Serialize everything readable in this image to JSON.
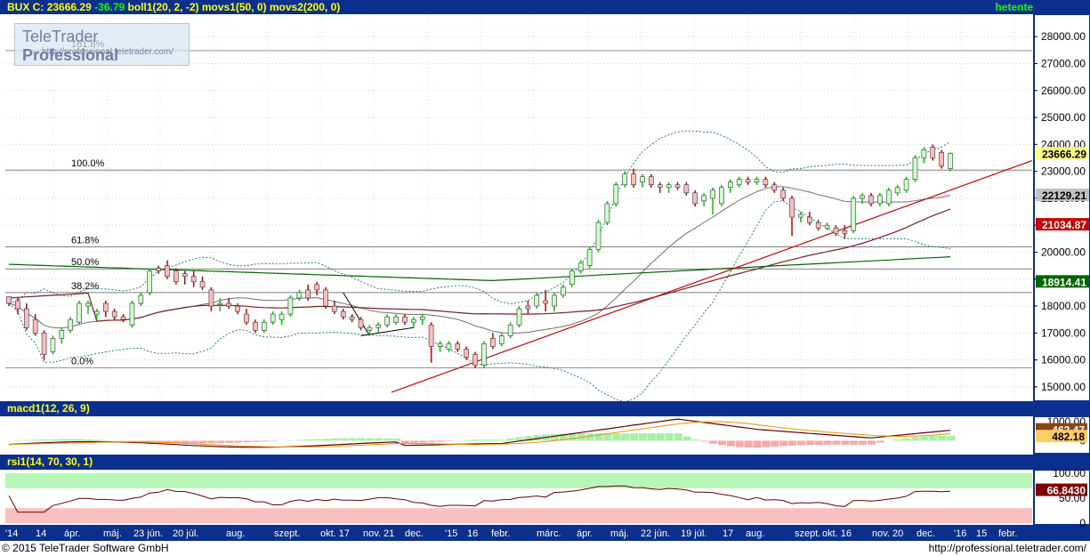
{
  "header": {
    "symbol": "BUX C:",
    "price": "23666.29",
    "change": "-36.79",
    "indicators": "boll1(20, 2, -2) movs1(50, 0) movs2(200, 0)",
    "period": "hetente"
  },
  "logo": {
    "brand": "TeleTrader",
    "product": "Professional",
    "url": "http://professional.teletrader.com/"
  },
  "macd_header": {
    "label": "macd1(12, 26, 9)"
  },
  "rsi_header": {
    "label": "rsi1(14, 70, 30, 1)"
  },
  "footer": {
    "copyright": "© 2015 TeleTrader Software GmbH",
    "url": "http://professional.teletrader.com/"
  },
  "colors": {
    "up": "#00cc00",
    "down": "#cc0000",
    "up_body": "#ccffcc",
    "down_body": "#ffbbbb",
    "bollinger": "#208080",
    "movs1": "#707070",
    "movs2": "#006600",
    "trendline": "#cc0000",
    "axis_bg": "#0a2f8c"
  },
  "chart_data": [
    {
      "type": "candlestick",
      "title": "BUX",
      "ylim": [
        14600,
        28700
      ],
      "y_ticks": [
        "15000.00",
        "16000.00",
        "17000.00",
        "18000.00",
        "19000.00",
        "20000.00",
        "21000.00",
        "22000.00",
        "23000.00",
        "24000.00",
        "25000.00",
        "26000.00",
        "27000.00",
        "28000.00"
      ],
      "price_labels": [
        {
          "value": "23666.29",
          "y": 23666.29,
          "bg": "#ffff80",
          "fg": "#000000"
        },
        {
          "value": "22129.21",
          "y": 22129.21,
          "bg": "#c0c0c0",
          "fg": "#000000"
        },
        {
          "value": "21034.87",
          "y": 21034.87,
          "bg": "#cc0000",
          "fg": "#ffffff"
        },
        {
          "value": "18914.41",
          "y": 18914.41,
          "bg": "#006600",
          "fg": "#ffffff"
        }
      ],
      "fibonacci": [
        {
          "label": "161.8%",
          "y": 27480
        },
        {
          "label": "100.0%",
          "y": 23050
        },
        {
          "label": "61.8%",
          "y": 20200
        },
        {
          "label": "50.0%",
          "y": 19380
        },
        {
          "label": "38.2%",
          "y": 18500
        },
        {
          "label": "0.0%",
          "y": 15700
        }
      ],
      "candles": [
        [
          18350,
          18350,
          18000,
          18100
        ],
        [
          18200,
          18300,
          17700,
          17900
        ],
        [
          17900,
          18100,
          17100,
          17200
        ],
        [
          17500,
          17700,
          16900,
          17000
        ],
        [
          17000,
          17100,
          16000,
          16200
        ],
        [
          16300,
          16900,
          16200,
          16800
        ],
        [
          16800,
          17200,
          16600,
          17100
        ],
        [
          17100,
          17600,
          17000,
          17500
        ],
        [
          17400,
          18200,
          17300,
          18100
        ],
        [
          18000,
          18200,
          17700,
          18100
        ],
        [
          17700,
          17900,
          17500,
          17800
        ],
        [
          18100,
          18200,
          17600,
          17800
        ],
        [
          17800,
          17900,
          17500,
          17600
        ],
        [
          17600,
          17700,
          17400,
          17500
        ],
        [
          17300,
          18200,
          17200,
          18100
        ],
        [
          18100,
          18500,
          18000,
          18400
        ],
        [
          18500,
          19400,
          18400,
          19300
        ],
        [
          19400,
          19500,
          19200,
          19300
        ],
        [
          19500,
          19700,
          19000,
          19100
        ],
        [
          19300,
          19400,
          18800,
          18900
        ],
        [
          19200,
          19300,
          18800,
          19100
        ],
        [
          19100,
          19300,
          18700,
          18900
        ],
        [
          18900,
          19100,
          18600,
          18700
        ],
        [
          18600,
          18700,
          17800,
          18000
        ],
        [
          18100,
          18300,
          17800,
          18100
        ],
        [
          18100,
          18300,
          17900,
          18000
        ],
        [
          18000,
          18100,
          17700,
          17800
        ],
        [
          17700,
          17900,
          17300,
          17400
        ],
        [
          17400,
          17500,
          17000,
          17100
        ],
        [
          17100,
          17500,
          17000,
          17400
        ],
        [
          17400,
          17800,
          17300,
          17700
        ],
        [
          17500,
          17800,
          17300,
          17700
        ],
        [
          17700,
          18400,
          17600,
          18300
        ],
        [
          18300,
          18600,
          18200,
          18500
        ],
        [
          18600,
          18800,
          18200,
          18300
        ],
        [
          18800,
          18900,
          18400,
          18600
        ],
        [
          18600,
          18700,
          17900,
          18000
        ],
        [
          18000,
          18200,
          17700,
          17800
        ],
        [
          17800,
          17900,
          17500,
          17600
        ],
        [
          17600,
          17700,
          17400,
          17500
        ],
        [
          17500,
          17600,
          17100,
          17200
        ],
        [
          17100,
          17300,
          16900,
          17200
        ],
        [
          17200,
          17400,
          17000,
          17300
        ],
        [
          17300,
          17700,
          17200,
          17600
        ],
        [
          17400,
          17700,
          17300,
          17600
        ],
        [
          17600,
          17700,
          17300,
          17400
        ],
        [
          17400,
          17600,
          17200,
          17500
        ],
        [
          17500,
          17700,
          17300,
          17600
        ],
        [
          17300,
          17400,
          15900,
          16500
        ],
        [
          16500,
          16700,
          16300,
          16600
        ],
        [
          16400,
          16700,
          16300,
          16600
        ],
        [
          16600,
          16700,
          16300,
          16400
        ],
        [
          16400,
          16500,
          16000,
          16100
        ],
        [
          16200,
          16300,
          15700,
          15800
        ],
        [
          15800,
          16700,
          15700,
          16600
        ],
        [
          16800,
          17000,
          16400,
          16500
        ],
        [
          16600,
          17000,
          16500,
          16900
        ],
        [
          16900,
          17400,
          16800,
          17300
        ],
        [
          17300,
          18000,
          17200,
          17900
        ],
        [
          18000,
          18200,
          17700,
          17900
        ],
        [
          18000,
          18500,
          17900,
          18400
        ],
        [
          18200,
          18600,
          17800,
          18100
        ],
        [
          18000,
          18500,
          17800,
          18400
        ],
        [
          18400,
          18800,
          18300,
          18700
        ],
        [
          18800,
          19400,
          18700,
          19300
        ],
        [
          19300,
          19700,
          19200,
          19600
        ],
        [
          19500,
          20200,
          19400,
          20100
        ],
        [
          20100,
          21200,
          20000,
          21100
        ],
        [
          21100,
          21900,
          21000,
          21800
        ],
        [
          21800,
          22600,
          21700,
          22500
        ],
        [
          22500,
          23000,
          22400,
          22900
        ],
        [
          22900,
          23100,
          22400,
          22500
        ],
        [
          22600,
          22900,
          22400,
          22800
        ],
        [
          22800,
          22900,
          22400,
          22500
        ],
        [
          22500,
          22600,
          22200,
          22400
        ],
        [
          22400,
          22600,
          22200,
          22500
        ],
        [
          22500,
          22600,
          22300,
          22400
        ],
        [
          22500,
          22600,
          22100,
          22200
        ],
        [
          22200,
          22300,
          21700,
          21800
        ],
        [
          21900,
          22200,
          21700,
          22100
        ],
        [
          22000,
          22400,
          21400,
          22300
        ],
        [
          21800,
          22500,
          21700,
          22400
        ],
        [
          22400,
          22700,
          22200,
          22600
        ],
        [
          22500,
          22800,
          22400,
          22700
        ],
        [
          22700,
          22800,
          22500,
          22600
        ],
        [
          22600,
          22800,
          22500,
          22700
        ],
        [
          22700,
          22800,
          22400,
          22500
        ],
        [
          22500,
          22600,
          22200,
          22300
        ],
        [
          22300,
          22400,
          21900,
          22000
        ],
        [
          22000,
          22100,
          20600,
          21300
        ],
        [
          21300,
          21500,
          21100,
          21400
        ],
        [
          21300,
          21500,
          21000,
          21100
        ],
        [
          21100,
          21200,
          20800,
          20900
        ],
        [
          20900,
          21100,
          20800,
          21000
        ],
        [
          20900,
          21000,
          20600,
          20700
        ],
        [
          20800,
          21000,
          20500,
          20700
        ],
        [
          20800,
          22100,
          20700,
          22000
        ],
        [
          22000,
          22200,
          21800,
          22100
        ],
        [
          22100,
          22200,
          21700,
          21800
        ],
        [
          21800,
          22200,
          21700,
          22100
        ],
        [
          21800,
          22400,
          21700,
          22300
        ],
        [
          22200,
          22500,
          22100,
          22400
        ],
        [
          22300,
          22800,
          22200,
          22700
        ],
        [
          22700,
          23600,
          22600,
          23500
        ],
        [
          23500,
          23900,
          23300,
          23800
        ],
        [
          23900,
          24000,
          23400,
          23500
        ],
        [
          23700,
          23800,
          23100,
          23200
        ],
        [
          23100,
          23700,
          23000,
          23666.29
        ]
      ],
      "x_labels": [
        "'14",
        "14",
        "ápr.",
        "máj.",
        "23 jún.",
        "20 júl.",
        "aug.",
        "szept.",
        "okt. 17",
        "nov. 21",
        "dec.",
        "'15",
        "16",
        "febr.",
        "márc.",
        "ápr.",
        "máj.",
        "22 jún.",
        "19 júl.",
        "17",
        "aug.",
        "szept.",
        "okt. 16",
        "nov. 20",
        "dec.",
        "'16",
        "15",
        "febr."
      ]
    },
    {
      "type": "line",
      "title": "macd1(12, 26, 9)",
      "y_ticks": [
        "1000.00",
        "500.00",
        "0"
      ],
      "price_labels": [
        {
          "value": "462.47",
          "y": 462.47,
          "bg": "#8b4513",
          "fg": "#ffffff"
        },
        {
          "value": "482.18",
          "y": 482.18,
          "bg": "#ffcc66",
          "fg": "#000000"
        }
      ]
    },
    {
      "type": "line",
      "title": "rsi1(14, 70, 30, 1)",
      "y_ticks": [
        "100.00",
        "50.00",
        "0"
      ],
      "price_labels": [
        {
          "value": "66.8430",
          "y": 66.843,
          "bg": "#800000",
          "fg": "#ffffff"
        }
      ]
    }
  ]
}
